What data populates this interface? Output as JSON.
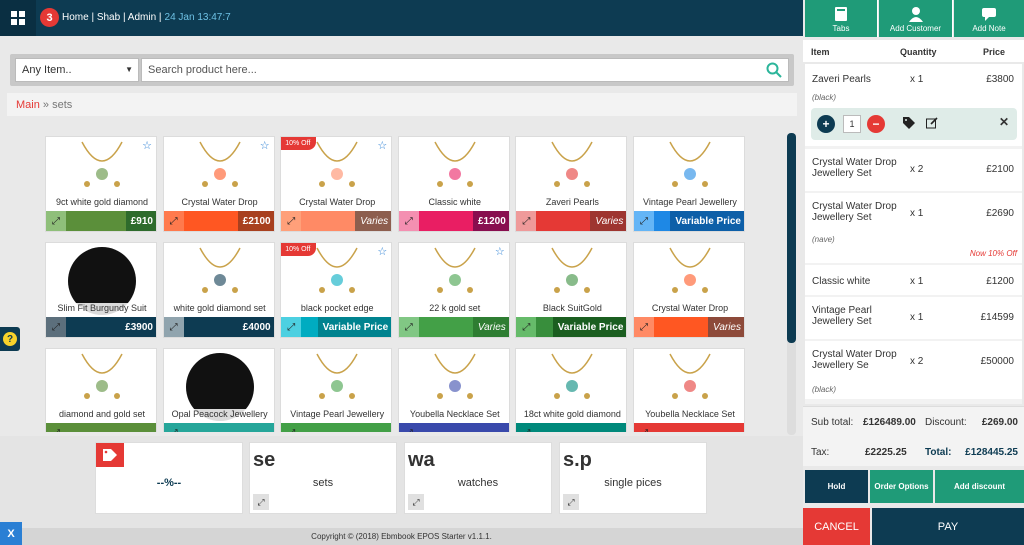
{
  "header": {
    "notif_count": "3",
    "nav_text": "Home | Shab | Admin |",
    "datetime": "24 Jan 13:47:7"
  },
  "search": {
    "category": "Any Item..",
    "placeholder": "Search product here..."
  },
  "breadcrumb": {
    "main": "Main",
    "sep": "»",
    "current": "sets"
  },
  "products": [
    {
      "name": "9ct white gold diamond",
      "price": "£910",
      "colors": [
        "#8fbf7a",
        "#5b8f3a",
        "#2e6b2c"
      ],
      "star": true,
      "discount": ""
    },
    {
      "name": "Crystal Water Drop",
      "price": "£2100",
      "colors": [
        "#ff7a4d",
        "#ff5722",
        "#a8401f"
      ],
      "star": true,
      "discount": ""
    },
    {
      "name": "Crystal Water Drop",
      "price": "Varies",
      "colors": [
        "#ffa07a",
        "#ff8a65",
        "#8d5e4e"
      ],
      "star": true,
      "discount": "10% Off"
    },
    {
      "name": "Classic white",
      "price": "£1200",
      "colors": [
        "#f48fb1",
        "#e91e63",
        "#880e4f"
      ],
      "star": false,
      "discount": ""
    },
    {
      "name": "Zaveri Pearls",
      "price": "Varies",
      "colors": [
        "#ef9a9a",
        "#e53935",
        "#9e3530"
      ],
      "star": false,
      "discount": ""
    },
    {
      "name": "Vintage Pearl Jewellery",
      "price": "Variable Price",
      "colors": [
        "#64b5f6",
        "#1e88e5",
        "#0d5fa8"
      ],
      "star": false,
      "discount": ""
    },
    {
      "name": "Slim Fit Burgundy Suit",
      "price": "£3900",
      "colors": [
        "#5c6f7c",
        "#0d3b52",
        "#0d3b52"
      ],
      "star": false,
      "discount": ""
    },
    {
      "name": "white gold diamond set",
      "price": "£4000",
      "colors": [
        "#90a4ae",
        "#0d3b52",
        "#0d3b52"
      ],
      "star": false,
      "discount": ""
    },
    {
      "name": "black pocket edge",
      "price": "Variable Price",
      "colors": [
        "#4dd0e1",
        "#00acc1",
        "#00838f"
      ],
      "star": true,
      "discount": "10% Off"
    },
    {
      "name": "22 k gold set",
      "price": "Varies",
      "colors": [
        "#81c784",
        "#43a047",
        "#2e7d32"
      ],
      "star": true,
      "discount": ""
    },
    {
      "name": "Black SuitGold",
      "price": "Variable Price",
      "colors": [
        "#66bb6a",
        "#388e3c",
        "#1b5e20"
      ],
      "star": false,
      "discount": ""
    },
    {
      "name": "Crystal Water Drop",
      "price": "Varies",
      "colors": [
        "#ff8a65",
        "#ff5722",
        "#8d4a3a"
      ],
      "star": false,
      "discount": ""
    },
    {
      "name": "diamond and gold set",
      "price": "",
      "colors": [
        "#5b8f3a",
        "#5b8f3a",
        "#5b8f3a"
      ],
      "star": false,
      "discount": ""
    },
    {
      "name": "Opal Peacock Jewellery",
      "price": "",
      "colors": [
        "#26a69a",
        "#26a69a",
        "#26a69a"
      ],
      "star": false,
      "discount": ""
    },
    {
      "name": "Vintage Pearl Jewellery",
      "price": "",
      "colors": [
        "#43a047",
        "#43a047",
        "#43a047"
      ],
      "star": false,
      "discount": ""
    },
    {
      "name": "Youbella Necklace Set",
      "price": "",
      "colors": [
        "#3949ab",
        "#3949ab",
        "#3949ab"
      ],
      "star": false,
      "discount": ""
    },
    {
      "name": "18ct white gold diamond",
      "price": "",
      "colors": [
        "#00897b",
        "#00897b",
        "#00897b"
      ],
      "star": false,
      "discount": ""
    },
    {
      "name": "Youbella Necklace Set",
      "price": "",
      "colors": [
        "#e53935",
        "#e53935",
        "#e53935"
      ],
      "star": false,
      "discount": ""
    }
  ],
  "categories": [
    {
      "abbr": "",
      "label": "--%--"
    },
    {
      "abbr": "se",
      "label": "sets"
    },
    {
      "abbr": "wa",
      "label": "watches"
    },
    {
      "abbr": "s.p",
      "label": "single pices"
    }
  ],
  "footer": "Copyright © (2018) Ebmbook EPOS Starter v1.1.1.",
  "x_btn": "X",
  "help": "?",
  "toolbar": {
    "tabs": "Tabs",
    "add_customer": "Add Customer",
    "add_note": "Add Note"
  },
  "cols": {
    "item": "Item",
    "qty": "Quantity",
    "price": "Price"
  },
  "order": [
    {
      "name1": "Zaveri Pearls",
      "name2": "",
      "qty": "x 1",
      "price": "£3800",
      "note": "(black)",
      "disc": ""
    },
    {
      "name1": "Crystal Water Drop",
      "name2": "Jewellery Set",
      "qty": "x 2",
      "price": "£2100",
      "note": "",
      "disc": ""
    },
    {
      "name1": "Crystal Water Drop",
      "name2": "Jewellery Set",
      "qty": "x 1",
      "price": "£2690",
      "note": "(nave)",
      "disc": "Now 10% Off"
    },
    {
      "name1": "Classic white",
      "name2": "",
      "qty": "x 1",
      "price": "£1200",
      "note": "",
      "disc": ""
    },
    {
      "name1": "Vintage Pearl",
      "name2": "Jewellery Set",
      "qty": "x 1",
      "price": "£14599",
      "note": "",
      "disc": ""
    },
    {
      "name1": "Crystal Water Drop",
      "name2": "Jewellery Se",
      "qty": "x 2",
      "price": "£50000",
      "note": "(black)",
      "disc": ""
    }
  ],
  "selected_qty": "1",
  "totals": {
    "subtotal_label": "Sub total:",
    "subtotal": "£126489.00",
    "discount_label": "Discount:",
    "discount": "£269.00",
    "tax_label": "Tax:",
    "tax": "£2225.25",
    "total_label": "Total:",
    "total": "£128445.25"
  },
  "actions": {
    "hold": "Hold",
    "order_options": "Order Options",
    "add_discount": "Add discount",
    "cancel": "CANCEL",
    "pay": "PAY"
  }
}
